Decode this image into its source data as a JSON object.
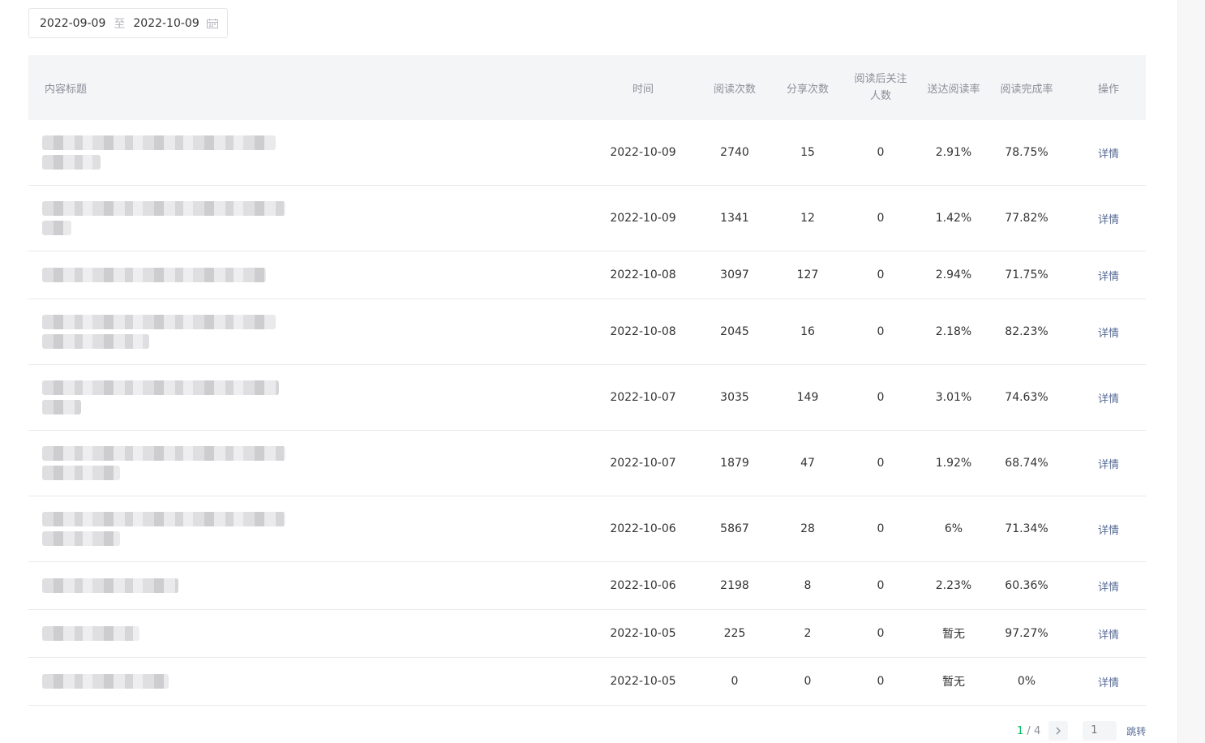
{
  "date_range": {
    "start": "2022-09-09",
    "separator": "至",
    "end": "2022-10-09"
  },
  "table": {
    "headers": {
      "title": "内容标题",
      "time": "时间",
      "reads": "阅读次数",
      "shares": "分享次数",
      "follow_line1": "阅读后关注",
      "follow_line2": "人数",
      "reach_rate": "送达阅读率",
      "complete_rate": "阅读完成率",
      "action": "操作"
    },
    "rows": [
      {
        "time": "2022-10-09",
        "reads": "2740",
        "shares": "15",
        "follows": "0",
        "reach_rate": "2.91%",
        "complete_rate": "78.75%",
        "action": "详情"
      },
      {
        "time": "2022-10-09",
        "reads": "1341",
        "shares": "12",
        "follows": "0",
        "reach_rate": "1.42%",
        "complete_rate": "77.82%",
        "action": "详情"
      },
      {
        "time": "2022-10-08",
        "reads": "3097",
        "shares": "127",
        "follows": "0",
        "reach_rate": "2.94%",
        "complete_rate": "71.75%",
        "action": "详情"
      },
      {
        "time": "2022-10-08",
        "reads": "2045",
        "shares": "16",
        "follows": "0",
        "reach_rate": "2.18%",
        "complete_rate": "82.23%",
        "action": "详情"
      },
      {
        "time": "2022-10-07",
        "reads": "3035",
        "shares": "149",
        "follows": "0",
        "reach_rate": "3.01%",
        "complete_rate": "74.63%",
        "action": "详情"
      },
      {
        "time": "2022-10-07",
        "reads": "1879",
        "shares": "47",
        "follows": "0",
        "reach_rate": "1.92%",
        "complete_rate": "68.74%",
        "action": "详情"
      },
      {
        "time": "2022-10-06",
        "reads": "5867",
        "shares": "28",
        "follows": "0",
        "reach_rate": "6%",
        "complete_rate": "71.34%",
        "action": "详情"
      },
      {
        "time": "2022-10-06",
        "reads": "2198",
        "shares": "8",
        "follows": "0",
        "reach_rate": "2.23%",
        "complete_rate": "60.36%",
        "action": "详情"
      },
      {
        "time": "2022-10-05",
        "reads": "225",
        "shares": "2",
        "follows": "0",
        "reach_rate": "暂无",
        "complete_rate": "97.27%",
        "action": "详情"
      },
      {
        "time": "2022-10-05",
        "reads": "0",
        "shares": "0",
        "follows": "0",
        "reach_rate": "暂无",
        "complete_rate": "0%",
        "action": "详情"
      }
    ]
  },
  "pagination": {
    "current": "1",
    "separator": " / ",
    "total": "4",
    "next_icon": "chevron-right-icon",
    "jump_placeholder": "1",
    "jump_label": "跳转"
  },
  "colors": {
    "accent_green": "#07c160",
    "link_blue": "#576b95",
    "header_bg": "#f4f5f7"
  }
}
